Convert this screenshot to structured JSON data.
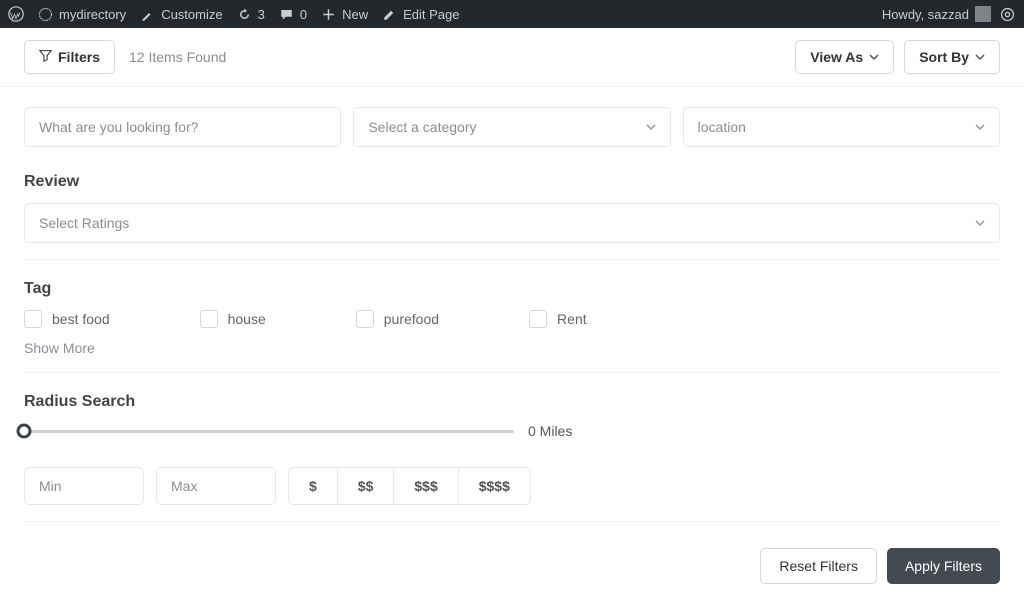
{
  "adminbar": {
    "site_name": "mydirectory",
    "customize": "Customize",
    "updates": "3",
    "comments": "0",
    "new": "New",
    "edit_page": "Edit Page",
    "howdy": "Howdy, sazzad"
  },
  "header": {
    "filters_label": "Filters",
    "items_found": "12 Items Found",
    "view_as": "View As",
    "sort_by": "Sort By"
  },
  "search": {
    "query_placeholder": "What are you looking for?",
    "category_placeholder": "Select a category",
    "location_placeholder": "location"
  },
  "review": {
    "title": "Review",
    "placeholder": "Select Ratings"
  },
  "tag": {
    "title": "Tag",
    "items": [
      "best food",
      "house",
      "purefood",
      "Rent"
    ],
    "show_more": "Show More"
  },
  "radius": {
    "title": "Radius Search",
    "value": "0 Miles"
  },
  "price": {
    "min_placeholder": "Min",
    "max_placeholder": "Max",
    "levels": [
      "$",
      "$$",
      "$$$",
      "$$$$"
    ]
  },
  "footer": {
    "reset": "Reset Filters",
    "apply": "Apply Filters"
  }
}
